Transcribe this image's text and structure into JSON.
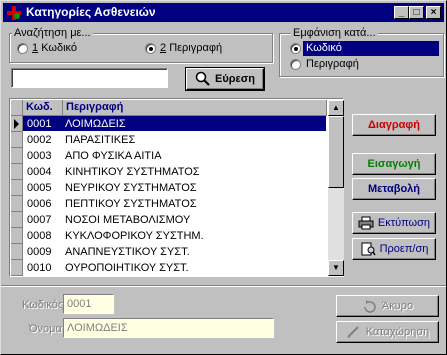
{
  "window": {
    "title": "Κατηγορίες Ασθενειών",
    "minimize": "_",
    "maximize": "□",
    "close": "×"
  },
  "search": {
    "group_label": "Αναζήτηση με...",
    "option1_num": "1",
    "option1_label": "Κωδικό",
    "option2_num": "2",
    "option2_label": "Περιγραφή",
    "selected": 2,
    "input_value": "",
    "button_label": "Εύρεση"
  },
  "display": {
    "group_label": "Εμφάνιση κατά...",
    "option1": "Κωδικό",
    "option2": "Περιγραφή",
    "selected": 1
  },
  "grid": {
    "columns": [
      "Κωδ.",
      "Περιγραφή"
    ],
    "rows": [
      [
        "0001",
        "ΛΟΙΜΩΔΕΙΣ"
      ],
      [
        "0002",
        "ΠΑΡΑΣΙΤΙΚΕΣ"
      ],
      [
        "0003",
        "ΑΠΟ ΦΥΣΙΚΑ ΑΙΤΙΑ"
      ],
      [
        "0004",
        "ΚΙΝΗΤΙΚΟΥ ΣΥΣΤΗΜΑΤΟΣ"
      ],
      [
        "0005",
        "ΝΕΥΡΙΚΟΥ ΣΥΣΤΗΜΑΤΟΣ"
      ],
      [
        "0006",
        "ΠΕΠΤΙΚΟΥ ΣΥΣΤΗΜΑΤΟΣ"
      ],
      [
        "0007",
        "ΝΟΣΟΙ ΜΕΤΑΒΟΛΙΣΜΟΥ"
      ],
      [
        "0008",
        "ΚΥΚΛΟΦΟΡΙΚΟΥ ΣΥΣΤΗΜ."
      ],
      [
        "0009",
        "ΑΝΑΠΝΕΥΣΤΙΚΟΥ ΣΥΣΤ."
      ],
      [
        "0010",
        "ΟΥΡΟΠΟΙΗΤΙΚΟΥ ΣΥΣΤ."
      ]
    ],
    "selected_row": 0
  },
  "actions": {
    "delete": "Διαγραφή",
    "insert": "Εισαγωγή",
    "edit": "Μεταβολή",
    "print": "Εκτύπωση",
    "preview": "Προεπ/ση"
  },
  "detail": {
    "code_label": "Κωδικός:",
    "code_value": "0001",
    "name_label": "Όνομα:",
    "name_value": "ΛΟΙΜΩΔΕΙΣ",
    "cancel": "Άκυρο",
    "save": "Καταχώρηση"
  },
  "colors": {
    "titlebar": "#000080",
    "delete": "#cc0000",
    "insert": "#008000",
    "edit": "#000080",
    "selection": "#000080"
  }
}
